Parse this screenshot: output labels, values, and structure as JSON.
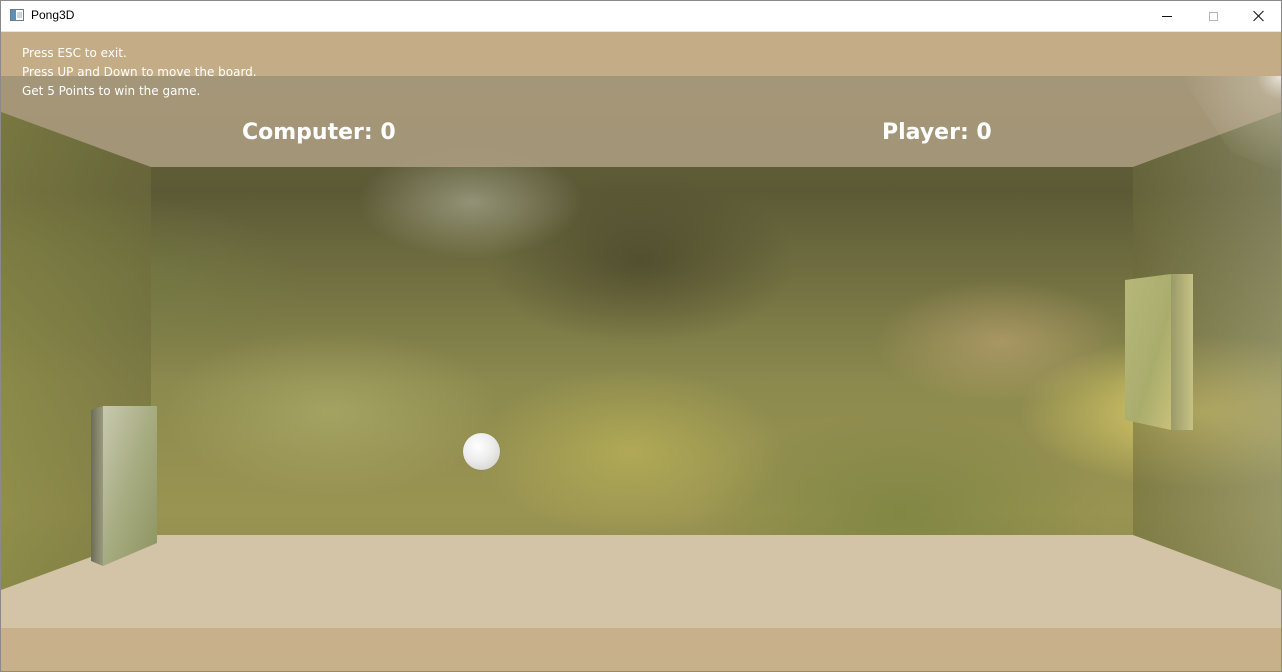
{
  "window": {
    "title": "Pong3D",
    "controls": {
      "minimize": "minimize-icon",
      "maximize": "maximize-icon",
      "close": "close-icon"
    }
  },
  "hud": {
    "instructions": [
      "Press ESC to exit.",
      "Press UP and Down to move the board.",
      "Get 5 Points to win the game."
    ],
    "computer_score_text": "Computer: 0",
    "player_score_text": "Player: 0"
  },
  "game": {
    "computer_score": 0,
    "player_score": 0,
    "points_to_win": 5
  },
  "colors": {
    "ceiling": "#c3ac86",
    "floor": "#d3c4a8",
    "hud_text": "#ffffff"
  }
}
